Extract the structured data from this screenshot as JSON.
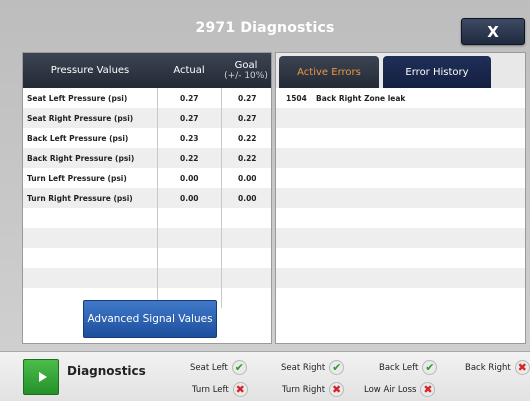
{
  "window": {
    "title": "2971 Diagnostics",
    "close_label": "X"
  },
  "pressure_table": {
    "headers": {
      "name": "Pressure Values",
      "actual": "Actual",
      "goal": "Goal",
      "goal_sub": "(+/- 10%)"
    },
    "rows": [
      {
        "name": "Seat Left Pressure (psi)",
        "actual": "0.27",
        "goal": "0.27"
      },
      {
        "name": "Seat Right Pressure (psi)",
        "actual": "0.27",
        "goal": "0.27"
      },
      {
        "name": "Back Left Pressure (psi)",
        "actual": "0.23",
        "goal": "0.22"
      },
      {
        "name": "Back Right Pressure (psi)",
        "actual": "0.22",
        "goal": "0.22"
      },
      {
        "name": "Turn Left Pressure (psi)",
        "actual": "0.00",
        "goal": "0.00"
      },
      {
        "name": "Turn Right Pressure (psi)",
        "actual": "0.00",
        "goal": "0.00"
      },
      {
        "name": "",
        "actual": "",
        "goal": ""
      },
      {
        "name": "",
        "actual": "",
        "goal": ""
      },
      {
        "name": "",
        "actual": "",
        "goal": ""
      },
      {
        "name": "",
        "actual": "",
        "goal": ""
      },
      {
        "name": "",
        "actual": "",
        "goal": ""
      }
    ],
    "advanced_button_label": "Advanced Signal Values"
  },
  "errors": {
    "tabs": [
      {
        "label": "Active Errors",
        "active": true
      },
      {
        "label": "Error History",
        "active": false
      }
    ],
    "rows": [
      {
        "code": "1504",
        "description": "Back Right Zone leak"
      },
      {
        "code": "",
        "description": ""
      },
      {
        "code": "",
        "description": ""
      },
      {
        "code": "",
        "description": ""
      },
      {
        "code": "",
        "description": ""
      },
      {
        "code": "",
        "description": ""
      },
      {
        "code": "",
        "description": ""
      },
      {
        "code": "",
        "description": ""
      },
      {
        "code": "",
        "description": ""
      },
      {
        "code": "",
        "description": ""
      },
      {
        "code": "",
        "description": ""
      }
    ]
  },
  "status_bar": {
    "label": "Diagnostics",
    "indicators": [
      {
        "label": "Seat Left",
        "status": "ok",
        "icon": "checkmark-icon"
      },
      {
        "label": "Seat Right",
        "status": "ok",
        "icon": "checkmark-icon"
      },
      {
        "label": "Back Left",
        "status": "ok",
        "icon": "checkmark-icon"
      },
      {
        "label": "Back Right",
        "status": "fail",
        "icon": "x-mark-icon"
      },
      {
        "label": "Turn Left",
        "status": "fail",
        "icon": "x-mark-icon"
      },
      {
        "label": "Turn Right",
        "status": "fail",
        "icon": "x-mark-icon"
      },
      {
        "label": "Low Air Loss",
        "status": "fail",
        "icon": "x-mark-icon"
      }
    ]
  },
  "colors": {
    "accent_orange": "#f0963a",
    "ok_green": "#2a9a2f",
    "fail_red": "#d42424",
    "button_blue": "#2a62b4"
  }
}
